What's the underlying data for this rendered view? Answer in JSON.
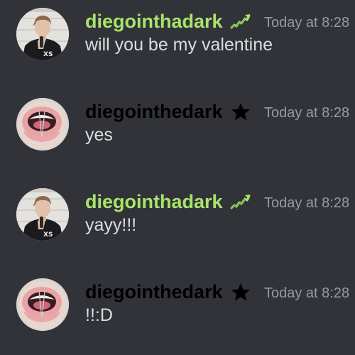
{
  "channel": {
    "messages": [
      {
        "author": "diegointhadark",
        "author_color": "#a8e36b",
        "badge_icon": "trending-up-icon",
        "avatar": "avatar-hoodie-boy",
        "timestamp": "Today at 8:28",
        "content": "will you be my valentine"
      },
      {
        "author": "diegointhedark",
        "author_color": "#000000",
        "badge_icon": "star-icon",
        "avatar": "avatar-mouth-closeup",
        "timestamp": "Today at 8:28",
        "content": "yes"
      },
      {
        "author": "diegointhadark",
        "author_color": "#a8e36b",
        "badge_icon": "trending-up-icon",
        "avatar": "avatar-hoodie-boy",
        "timestamp": "Today at 8:28",
        "content": "yayy!!!"
      },
      {
        "author": "diegointhedark",
        "author_color": "#000000",
        "badge_icon": "star-icon",
        "avatar": "avatar-mouth-closeup",
        "timestamp": "Today at 8:28",
        "content": "!!:D"
      }
    ]
  },
  "colors": {
    "background": "#313338",
    "timestamp": "#949ba4",
    "message_text": "#dbdee1",
    "trend_badge": "#a8e36b"
  }
}
